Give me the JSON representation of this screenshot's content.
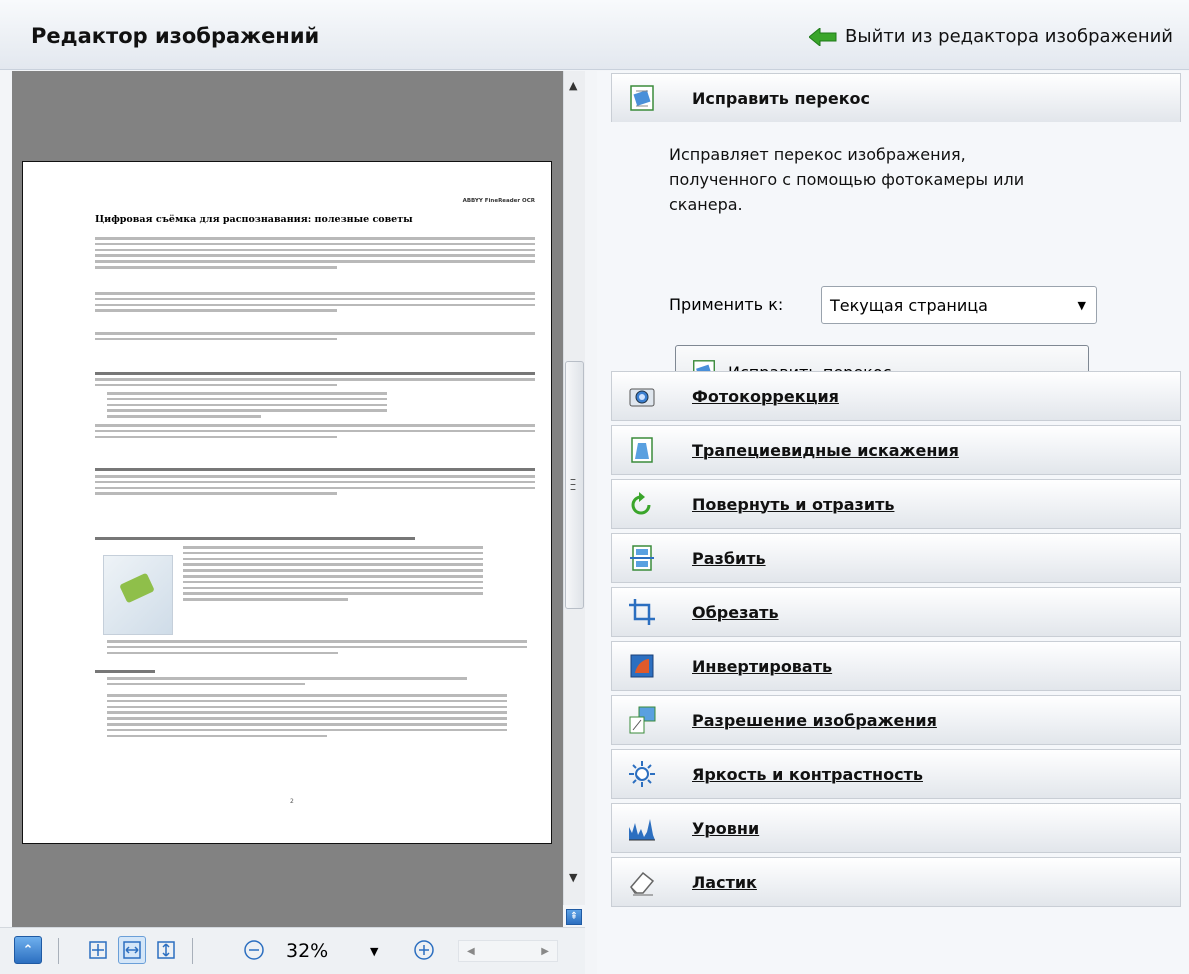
{
  "app": {
    "title": "Редактор изображений",
    "exit_label": "Выйти из редактора изображений"
  },
  "preview": {
    "page_header": "ABBYY FineReader OCR",
    "doc_title": "Цифровая съёмка для распознавания: полезные советы",
    "page_number": "2"
  },
  "toolbar": {
    "zoom_value": "32%"
  },
  "deskew": {
    "header": "Исправить перекос",
    "description": "Исправляет перекос изображения, полученного с помощью фотокамеры или сканера.",
    "apply_label": "Применить к:",
    "apply_value": "Текущая страница",
    "button_label": "Исправить перекос"
  },
  "sections": [
    {
      "label": "Фотокоррекция",
      "icon": "camera-icon"
    },
    {
      "label": "Трапециевидные искажения",
      "icon": "perspective-icon"
    },
    {
      "label": "Повернуть и отразить",
      "icon": "rotate-icon"
    },
    {
      "label": "Разбить",
      "icon": "split-icon"
    },
    {
      "label": "Обрезать",
      "icon": "crop-icon"
    },
    {
      "label": "Инвертировать",
      "icon": "invert-icon"
    },
    {
      "label": "Разрешение изображения",
      "icon": "resolution-icon"
    },
    {
      "label": "Яркость и контрастность",
      "icon": "brightness-icon"
    },
    {
      "label": "Уровни",
      "icon": "levels-icon"
    },
    {
      "label": "Ластик",
      "icon": "eraser-icon"
    }
  ],
  "colors": {
    "accent_green": "#3aa52b",
    "accent_blue": "#2c6fc0"
  }
}
